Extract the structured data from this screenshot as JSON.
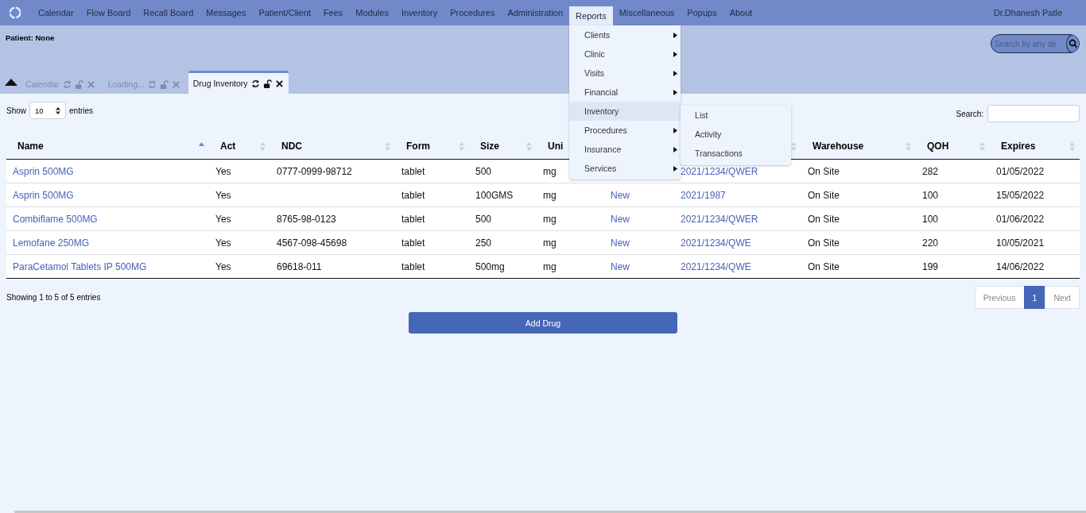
{
  "nav": {
    "items": [
      {
        "label": "Calendar",
        "selected": false
      },
      {
        "label": "Flow Board",
        "selected": false
      },
      {
        "label": "Recall Board",
        "selected": false
      },
      {
        "label": "Messages",
        "selected": false
      },
      {
        "label": "Patient/Client",
        "selected": false
      },
      {
        "label": "Fees",
        "selected": false
      },
      {
        "label": "Modules",
        "selected": false
      },
      {
        "label": "Inventory",
        "selected": false
      },
      {
        "label": "Procedures",
        "selected": false
      },
      {
        "label": "Administration",
        "selected": false
      },
      {
        "label": "Reports",
        "selected": true
      },
      {
        "label": "Miscellaneous",
        "selected": false
      },
      {
        "label": "Popups",
        "selected": false
      },
      {
        "label": "About",
        "selected": false
      }
    ],
    "user": "Dr.Dhanesh Patle"
  },
  "patient": "Patient: None",
  "search": {
    "placeholder": "Search by any de"
  },
  "tabs": [
    {
      "label": "Calendar",
      "selected": false
    },
    {
      "label": "Loading...",
      "selected": false
    },
    {
      "label": "Drug Inventory",
      "selected": true
    }
  ],
  "reports_menu": {
    "items": [
      {
        "label": "Clients",
        "submenu": true,
        "selected": false
      },
      {
        "label": "Clinic",
        "submenu": true,
        "selected": false
      },
      {
        "label": "Visits",
        "submenu": true,
        "selected": false
      },
      {
        "label": "Financial",
        "submenu": true,
        "selected": false
      },
      {
        "label": "Inventory",
        "submenu": false,
        "selected": true
      },
      {
        "label": "Procedures",
        "submenu": true,
        "selected": false
      },
      {
        "label": "Insurance",
        "submenu": true,
        "selected": false
      },
      {
        "label": "Services",
        "submenu": true,
        "selected": false
      }
    ],
    "submenu": [
      "List",
      "Activity",
      "Transactions"
    ]
  },
  "length": {
    "label_before": "Show",
    "value": "10",
    "label_after": "entries"
  },
  "filter": {
    "label": "Search:"
  },
  "table": {
    "columns": [
      {
        "label": "Name",
        "sorted": true
      },
      {
        "label": "Act",
        "sorted": false
      },
      {
        "label": "NDC",
        "sorted": false
      },
      {
        "label": "Form",
        "sorted": false
      },
      {
        "label": "Size",
        "sorted": false
      },
      {
        "label": "Uni"
      },
      {},
      {
        "sorted": false
      },
      {
        "label": "Warehouse",
        "sorted": false
      },
      {
        "label": "QOH",
        "sorted": false
      },
      {
        "label": "Expires",
        "sorted": false
      }
    ],
    "rows": [
      {
        "cells": [
          "Asprin 500MG",
          "Yes",
          "0777-0999-98712",
          "tablet",
          "500",
          "mg",
          null,
          "2021/1234/QWER",
          "On Site",
          "282",
          "01/05/2022"
        ]
      },
      {
        "cells": [
          "Asprin 500MG",
          "Yes",
          null,
          "tablet",
          "100GMS",
          "mg",
          "New",
          "2021/1987",
          "On Site",
          "100",
          "15/05/2022"
        ]
      },
      {
        "cells": [
          "Combiflame 500MG",
          "Yes",
          "8765-98-0123",
          "tablet",
          "500",
          "mg",
          "New",
          "2021/1234/QWER",
          "On Site",
          "100",
          "01/06/2022"
        ]
      },
      {
        "cells": [
          "Lemofane 250MG",
          "Yes",
          "4567-098-45698",
          "tablet",
          "250",
          "mg",
          "New",
          "2021/1234/QWE",
          "On Site",
          "220",
          "10/05/2021"
        ]
      },
      {
        "cells": [
          "ParaCetamol Tablets IP 500MG",
          "Yes",
          "69618-011",
          "tablet",
          "500mg",
          "mg",
          "New",
          "2021/1234/QWE",
          "On Site",
          "199",
          "14/06/2022"
        ]
      }
    ]
  },
  "info": "Showing 1 to 5 of 5 entries",
  "pagination": [
    {
      "label": "Previous",
      "selected": false
    },
    {
      "label": "1",
      "selected": true
    },
    {
      "label": "Next",
      "selected": false
    }
  ],
  "add_button": "Add Drug"
}
